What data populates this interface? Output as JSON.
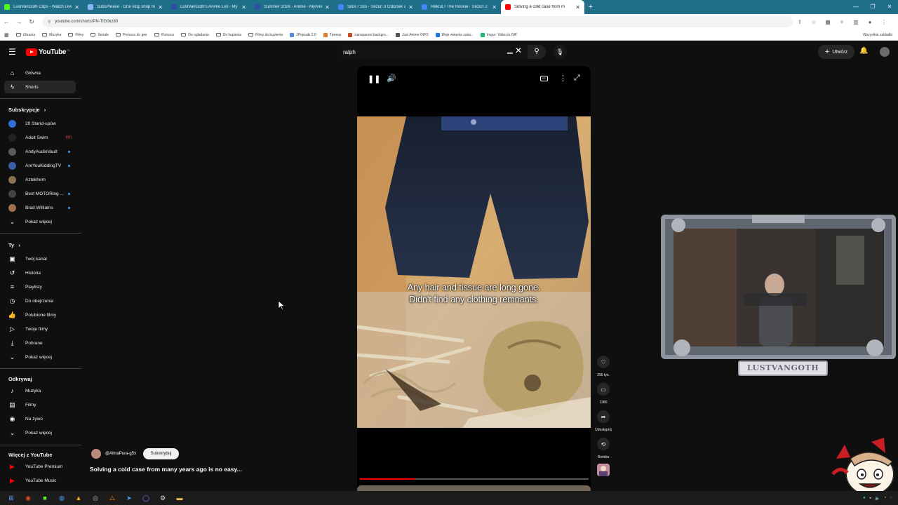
{
  "browser": {
    "tabs": [
      {
        "label": "LustVanGoth Clips - Watch Live",
        "favicon_color": "#53fc18",
        "active": false
      },
      {
        "label": "SubsPlease - One stop shop for",
        "favicon_color": "#8ab4f8",
        "active": false
      },
      {
        "label": "LustVanGoth's Anime List - My",
        "favicon_color": "#2e51a2",
        "active": false
      },
      {
        "label": "Summer 2026 - Anime - MyAnim",
        "favicon_color": "#2e51a2",
        "active": false
      },
      {
        "label": "Silos / Silo - Sezon 3 Odcinek 2",
        "favicon_color": "#4285f4",
        "active": false
      },
      {
        "label": "Rekrut / The Rookie - Sezon 2",
        "favicon_color": "#4285f4",
        "active": false
      },
      {
        "label": "Solving a cold case from m",
        "favicon_color": "#ff0000",
        "active": true
      }
    ],
    "url": "youtube.com/shorts/PN-TiG0kz80",
    "bookmarks": [
      {
        "label": "Ubrania",
        "type": "folder"
      },
      {
        "label": "Muzyka",
        "type": "folder"
      },
      {
        "label": "Filmy",
        "type": "folder"
      },
      {
        "label": "Seriale",
        "type": "folder"
      },
      {
        "label": "Pomoce do gier",
        "type": "folder"
      },
      {
        "label": "Pomoce",
        "type": "folder"
      },
      {
        "label": "Do ogladania",
        "type": "folder"
      },
      {
        "label": "Do kupienia",
        "type": "folder"
      },
      {
        "label": "Filmy do kupienia",
        "type": "folder"
      },
      {
        "label": "JPopsuki 2.0",
        "type": "site",
        "color": "#4a90d9"
      },
      {
        "label": "Tpeesp",
        "type": "site",
        "color": "#e07b2a"
      },
      {
        "label": "transparent backgro...",
        "type": "site",
        "color": "#c94c2a"
      },
      {
        "label": "Just Anime GIFS",
        "type": "site",
        "color": "#555555"
      },
      {
        "label": "Moje wtepnie zatw...",
        "type": "site",
        "color": "#1a73e8"
      },
      {
        "label": "Imgur: Video to GIF",
        "type": "site",
        "color": "#1bb76e"
      }
    ],
    "other_bookmarks": "Wszystkie zakładki"
  },
  "masthead": {
    "logo_text": "YouTube",
    "logo_country": "PL",
    "search_value": "ralph",
    "create_label": "Utwórz"
  },
  "sidebar": {
    "main": [
      {
        "label": "Główna",
        "icon": "home-icon",
        "glyph": "⌂",
        "active": false
      },
      {
        "label": "Shorts",
        "icon": "shorts-icon",
        "glyph": "ϟ",
        "active": true
      }
    ],
    "subs_header": "Subskrypcje",
    "subscriptions": [
      {
        "label": "20 Stand-upów",
        "color": "#2f6fd6",
        "indicator": "none"
      },
      {
        "label": "Adult Swim",
        "color": "#222222",
        "indicator": "live"
      },
      {
        "label": "AndyAudioVault",
        "color": "#5a5a5a",
        "indicator": "dot"
      },
      {
        "label": "AreYouKiddingTV",
        "color": "#3a5ea8",
        "indicator": "dot"
      },
      {
        "label": "Aztekhem",
        "color": "#8a7350",
        "indicator": "none"
      },
      {
        "label": "Best MOTORing ...",
        "color": "#444444",
        "indicator": "dot"
      },
      {
        "label": "Brad Williams",
        "color": "#a07050",
        "indicator": "dot"
      }
    ],
    "subs_more": "Pokaż więcej",
    "you_header": "Ty",
    "you_items": [
      {
        "label": "Twój kanał",
        "icon": "channel-icon",
        "glyph": "▣"
      },
      {
        "label": "Historia",
        "icon": "history-icon",
        "glyph": "↺"
      },
      {
        "label": "Playlisty",
        "icon": "playlists-icon",
        "glyph": "≡"
      },
      {
        "label": "Do obejrzenia",
        "icon": "watch-later-icon",
        "glyph": "◷"
      },
      {
        "label": "Polubione filmy",
        "icon": "liked-icon",
        "glyph": "👍"
      },
      {
        "label": "Twoje filmy",
        "icon": "your-videos-icon",
        "glyph": "▷"
      },
      {
        "label": "Pobrane",
        "icon": "download-icon",
        "glyph": "⤓"
      }
    ],
    "you_more": "Pokaż więcej",
    "explore_header": "Odkrywaj",
    "explore_items": [
      {
        "label": "Muzyka",
        "icon": "music-icon",
        "glyph": "♪"
      },
      {
        "label": "Filmy",
        "icon": "movies-icon",
        "glyph": "▤"
      },
      {
        "label": "Na żywo",
        "icon": "live-icon",
        "glyph": "◉"
      }
    ],
    "explore_more": "Pokaż więcej",
    "more_header": "Więcej z YouTube",
    "more_items": [
      {
        "label": "YouTube Premium",
        "color": "#ff0000"
      },
      {
        "label": "YouTube Music",
        "color": "#ff0000"
      }
    ]
  },
  "short": {
    "subtitle_line1": "Any hair and tissue are long gone.",
    "subtitle_line2": "Didn't find any clothing remnants.",
    "progress": 0.24,
    "channel": "@AlmaPura-g5x",
    "subscribe_label": "Subskrybuj",
    "title": "Solving a cold case from many years ago is no easy..."
  },
  "actions": {
    "likes": "295 tys.",
    "comments": "1380",
    "share": "Udostępnij",
    "remix": "Remiks"
  },
  "overlay": {
    "streamer_name": "LUSTVANGOTH"
  },
  "colors": {
    "accent": "#ff0000",
    "background": "#0f0f0f",
    "tab_strip": "#1f6f8b"
  }
}
